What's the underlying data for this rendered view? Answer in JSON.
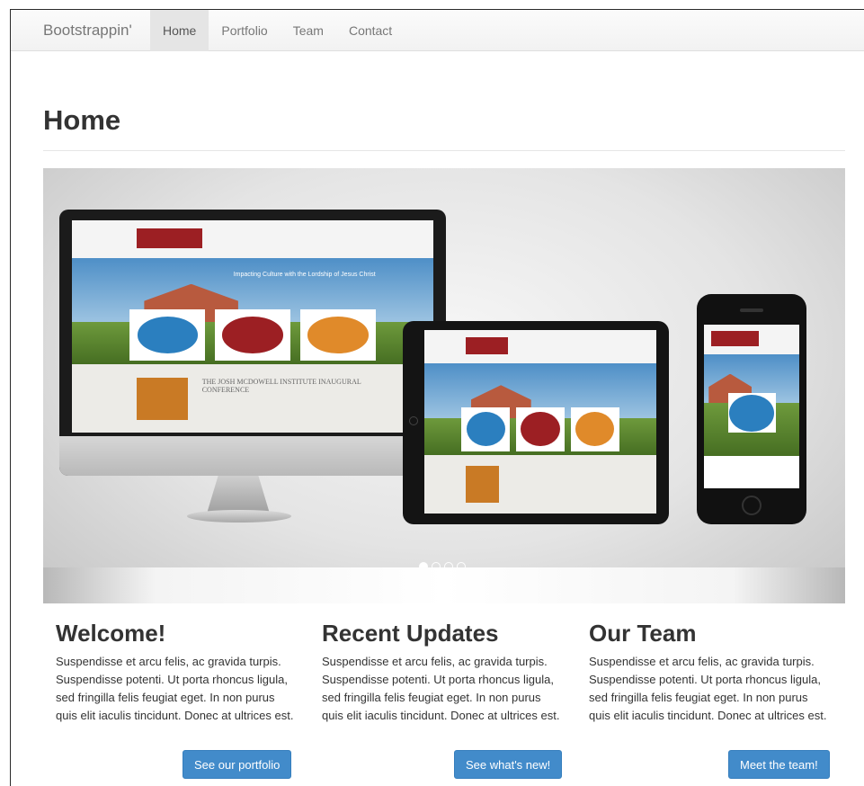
{
  "navbar": {
    "brand": "Bootstrappin'",
    "items": [
      {
        "label": "Home",
        "active": true
      },
      {
        "label": "Portfolio",
        "active": false
      },
      {
        "label": "Team",
        "active": false
      },
      {
        "label": "Contact",
        "active": false
      }
    ]
  },
  "page": {
    "title": "Home"
  },
  "carousel": {
    "slide_count": 4,
    "active_index": 0,
    "slide_image": "responsive-devices-mockup",
    "screen_text": {
      "tagline": "Impacting Culture with the Lordship of Jesus Christ",
      "headline": "THE JOSH MCDOWELL INSTITUTE INAUGURAL CONFERENCE"
    }
  },
  "columns": [
    {
      "heading": "Welcome!",
      "body": "Suspendisse et arcu felis, ac gravida turpis. Suspendisse potenti. Ut porta rhoncus ligula, sed fringilla felis feugiat eget. In non purus quis elit iaculis tincidunt. Donec at ultrices est.",
      "button": "See our portfolio"
    },
    {
      "heading": "Recent Updates",
      "body": "Suspendisse et arcu felis, ac gravida turpis. Suspendisse potenti. Ut porta rhoncus ligula, sed fringilla felis feugiat eget. In non purus quis elit iaculis tincidunt. Donec at ultrices est.",
      "button": "See what's new!"
    },
    {
      "heading": "Our Team",
      "body": "Suspendisse et arcu felis, ac gravida turpis. Suspendisse potenti. Ut porta rhoncus ligula, sed fringilla felis feugiat eget. In non purus quis elit iaculis tincidunt. Donec at ultrices est.",
      "button": "Meet the team!"
    }
  ],
  "colors": {
    "primary_button": "#428bca",
    "navbar_active": "#e5e5e5",
    "brand_red": "#9c1f23"
  }
}
